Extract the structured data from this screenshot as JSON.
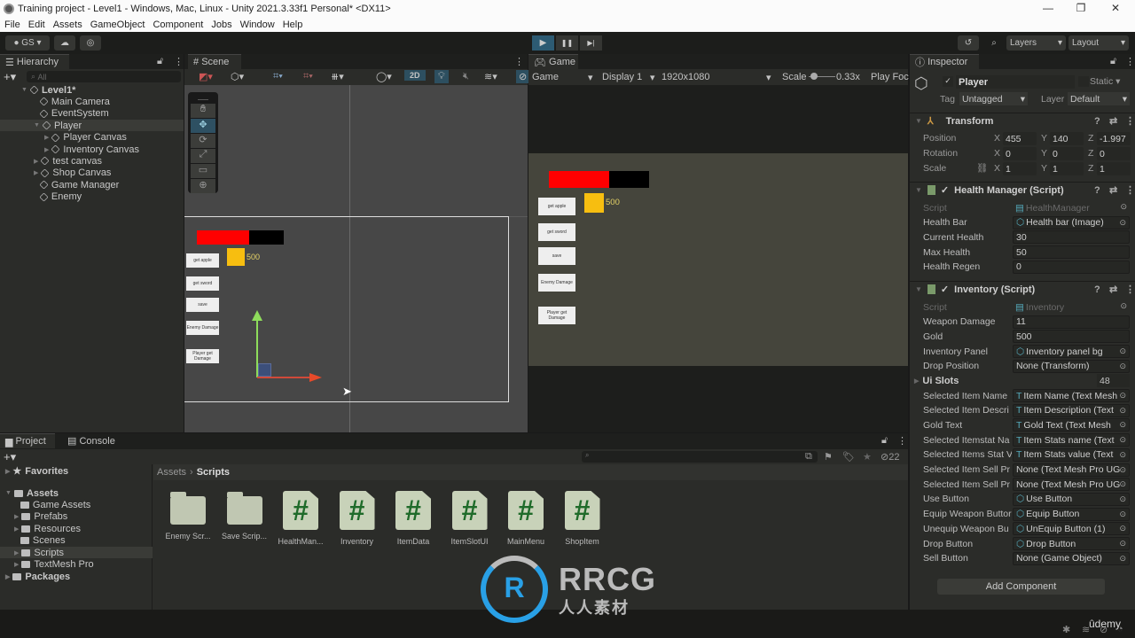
{
  "window": {
    "title": "Training project - Level1 - Windows, Mac, Linux - Unity 2021.3.33f1 Personal* <DX11>",
    "minimize_icon": "minimize-icon",
    "maximize_icon": "maximize-icon",
    "close_icon": "close-icon"
  },
  "menu": [
    "File",
    "Edit",
    "Assets",
    "GameObject",
    "Component",
    "Jobs",
    "Window",
    "Help"
  ],
  "toolbar": {
    "account": "GS",
    "layers": "Layers",
    "layout": "Layout",
    "play_icon": "▶",
    "pause_icon": "❚❚",
    "step_icon": "▶|"
  },
  "hierarchy": {
    "tab": "Hierarchy",
    "search_placeholder": "All",
    "items": [
      {
        "label": "Level1*",
        "depth": 0
      },
      {
        "label": "Main Camera",
        "depth": 1
      },
      {
        "label": "EventSystem",
        "depth": 1
      },
      {
        "label": "Player",
        "depth": 1,
        "selected": true
      },
      {
        "label": "Player Canvas",
        "depth": 2
      },
      {
        "label": "Inventory Canvas",
        "depth": 2
      },
      {
        "label": "test canvas",
        "depth": 1
      },
      {
        "label": "Shop Canvas",
        "depth": 1
      },
      {
        "label": "Game Manager",
        "depth": 1
      },
      {
        "label": "Enemy",
        "depth": 1
      }
    ]
  },
  "scene": {
    "tab": "Scene",
    "mode_2d": "2D",
    "ui": {
      "gold_value": "500",
      "health_fill": 0.6,
      "buttons": [
        "get apple",
        "get sword",
        "save",
        "Enemy Damage",
        "Player get Damage"
      ]
    }
  },
  "game": {
    "tab": "Game",
    "view_select": "Game",
    "display": "Display 1",
    "resolution": "1920x1080",
    "scale_label": "Scale",
    "scale_value": "0.33x",
    "play_focus": "Play Foc",
    "ui": {
      "gold_value": "500",
      "health_fill": 0.6,
      "buttons": [
        "get apple",
        "get sword",
        "save",
        "Enemy Damage",
        "Player get Damage"
      ]
    }
  },
  "inspector": {
    "tab": "Inspector",
    "object_name": "Player",
    "static_label": "Static",
    "tag_label": "Tag",
    "tag_value": "Untagged",
    "layer_label": "Layer",
    "layer_value": "Default",
    "transform": {
      "title": "Transform",
      "position": {
        "label": "Position",
        "x": "455",
        "y": "140",
        "z": "-1.997"
      },
      "rotation": {
        "label": "Rotation",
        "x": "0",
        "y": "0",
        "z": "0"
      },
      "scale": {
        "label": "Scale",
        "x": "1",
        "y": "1",
        "z": "1"
      }
    },
    "health_manager": {
      "title": "Health Manager (Script)",
      "fields": [
        {
          "label": "Script",
          "value": "HealthManager",
          "disabled": true
        },
        {
          "label": "Health Bar",
          "value": "Health bar (Image)"
        },
        {
          "label": "Current Health",
          "value": "30"
        },
        {
          "label": "Max Health",
          "value": "50"
        },
        {
          "label": "Health Regen",
          "value": "0"
        }
      ]
    },
    "inventory": {
      "title": "Inventory (Script)",
      "fields": [
        {
          "label": "Script",
          "value": "Inventory",
          "disabled": true
        },
        {
          "label": "Weapon Damage",
          "value": "11"
        },
        {
          "label": "Gold",
          "value": "500"
        },
        {
          "label": "Inventory Panel",
          "value": "Inventory panel bg"
        },
        {
          "label": "Drop Position",
          "value": "None (Transform)"
        }
      ],
      "ui_slots_label": "Ui Slots",
      "ui_slots_value": "48",
      "fields2": [
        {
          "label": "Selected Item Name",
          "value": "Item Name (Text Mesh"
        },
        {
          "label": "Selected Item Descri",
          "value": "Item Description (Text"
        },
        {
          "label": "Gold Text",
          "value": "Gold Text (Text Mesh"
        },
        {
          "label": "Selected Itemstat Na",
          "value": "Item Stats name (Text"
        },
        {
          "label": "Selected Items Stat V",
          "value": "Item Stats value (Text"
        },
        {
          "label": "Selected Item Sell Pr",
          "value": "None (Text Mesh Pro UG"
        },
        {
          "label": "Selected Item Sell Pr",
          "value": "None (Text Mesh Pro UG"
        },
        {
          "label": "Use Button",
          "value": "Use Button"
        },
        {
          "label": "Equip Weapon Buttor",
          "value": "Equip Button"
        },
        {
          "label": "Unequip Weapon Bu",
          "value": "UnEquip Button (1)"
        },
        {
          "label": "Drop Button",
          "value": "Drop Button"
        },
        {
          "label": "Sell Button",
          "value": "None (Game Object)"
        }
      ]
    },
    "add_component": "Add Component"
  },
  "project": {
    "tabs": [
      "Project",
      "Console"
    ],
    "favorites": "Favorites",
    "tree": [
      {
        "label": "Assets",
        "depth": 0
      },
      {
        "label": "Game Assets",
        "depth": 1
      },
      {
        "label": "Prefabs",
        "depth": 1
      },
      {
        "label": "Resources",
        "depth": 1
      },
      {
        "label": "Scenes",
        "depth": 1
      },
      {
        "label": "Scripts",
        "depth": 1,
        "selected": true
      },
      {
        "label": "TextMesh Pro",
        "depth": 1
      },
      {
        "label": "Packages",
        "depth": 0
      }
    ],
    "breadcrumb": [
      "Assets",
      "Scripts"
    ],
    "hidden_count": "22",
    "assets": [
      {
        "label": "Enemy Scr...",
        "type": "folder"
      },
      {
        "label": "Save Scrip...",
        "type": "folder"
      },
      {
        "label": "HealthMan...",
        "type": "script"
      },
      {
        "label": "Inventory",
        "type": "script"
      },
      {
        "label": "ItemData",
        "type": "script"
      },
      {
        "label": "ItemSlotUI",
        "type": "script"
      },
      {
        "label": "MainMenu",
        "type": "script"
      },
      {
        "label": "ShopItem",
        "type": "script"
      }
    ]
  },
  "watermark": {
    "brand": "RRCG",
    "sub": "人人素材",
    "udemy": "ûdemy"
  }
}
